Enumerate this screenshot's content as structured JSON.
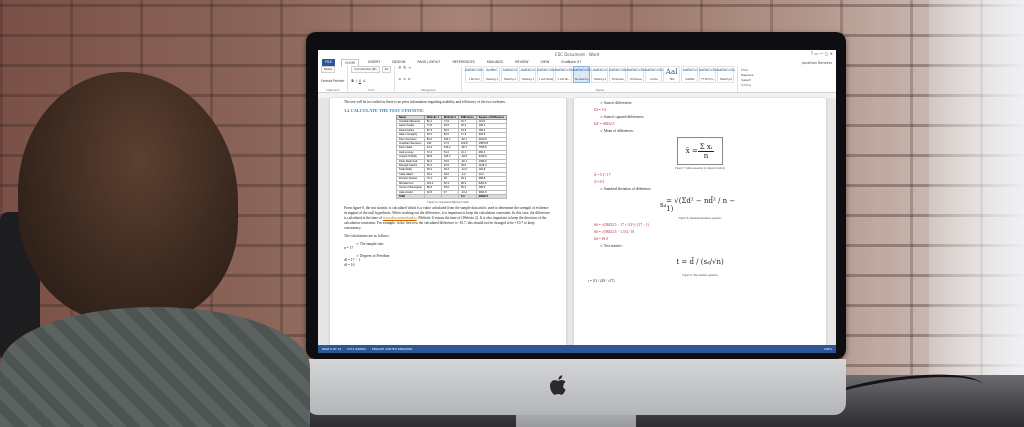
{
  "photo": {
    "description_only": false
  },
  "word": {
    "title": "CSC Document - Word",
    "tabs": [
      "FILE",
      "HOME",
      "INSERT",
      "DESIGN",
      "PAGE LAYOUT",
      "REFERENCES",
      "MAILINGS",
      "REVIEW",
      "VIEW",
      "EndNote X7"
    ],
    "active_tab": "HOME",
    "user": "Jonathan Beneers",
    "clipboard": {
      "paste": "Paste",
      "format_painter": "Format Painter",
      "group": "Clipboard"
    },
    "font": {
      "name": "Constantia (Bo",
      "size": "10",
      "group": "Font"
    },
    "paragraph_group": "Paragraph",
    "styles_group": "Styles",
    "styles": [
      {
        "sample": "AaBbCcDc",
        "name": "1 Normal"
      },
      {
        "sample": "AaBbC",
        "name": "Heading 1"
      },
      {
        "sample": "AaBbCcI",
        "name": "Heading 2"
      },
      {
        "sample": "AaBbCcI",
        "name": "Heading 3"
      },
      {
        "sample": "AaBbCcDc",
        "name": "1 List Bullet"
      },
      {
        "sample": "AaBbCcDc",
        "name": "1 List Nu..."
      },
      {
        "sample": "AaBbCcDc",
        "name": "No Spacing"
      },
      {
        "sample": "AaBbCcI",
        "name": "Heading 4"
      },
      {
        "sample": "AaBbCcDc",
        "name": "Emphasis"
      },
      {
        "sample": "AaBbCcDc",
        "name": "Emphasis"
      },
      {
        "sample": "AaBbCcDc",
        "name": "Quote"
      },
      {
        "sample": "AaI",
        "name": "Title"
      },
      {
        "sample": "AaBbCcI",
        "name": "Subtitle"
      },
      {
        "sample": "AaBbCcDc",
        "name": "TT Std Hy..."
      },
      {
        "sample": "AaBbCcDc",
        "name": "Heading 6"
      }
    ],
    "editing": {
      "find": "Find",
      "replace": "Replace",
      "select": "Select",
      "group": "Editing"
    },
    "left_page": {
      "intro": "The test will be two tailed as there is no prior information regarding usability and efficiency of the two websites.",
      "heading": "3.4 CALCULATE THE TEST STATISTIC",
      "table_headers": [
        "Name",
        "Website 1",
        "Website 2",
        "Difference",
        "Square of Difference"
      ],
      "table_rows": [
        [
          "Jonathan Beneers",
          "81.2",
          "71.9",
          "10.7",
          "114.5"
        ],
        [
          "Aaron Fowler",
          "71.8",
          "49.6",
          "22.2",
          "100.3"
        ],
        [
          "David Collins",
          "87.3",
          "56.0",
          "31.3",
          "199.2"
        ],
        [
          "Adam Geraghty",
          "94.2",
          "52.0",
          "17.4",
          "302.8"
        ],
        [
          "Dan Lhompson",
          "81.0",
          "102.1",
          "-52.1",
          "2616.8"
        ],
        [
          "Jonathan Sampson",
          "130",
          "27.2",
          "102.8",
          "10579.8"
        ],
        [
          "Dewn Salla",
          "44.4",
          "120.2",
          "-66.7",
          "7535.5"
        ],
        [
          "Jack Looney",
          "72.4",
          "51.2",
          "21.1",
          "260.2"
        ],
        [
          "Joseph O'Reilly",
          "86.8",
          "105.4",
          "-18.6",
          "3429.9"
        ],
        [
          "Peter Redmond",
          "52.2",
          "78.6",
          "-46.1",
          "1396.0"
        ],
        [
          "Darragh Kearns",
          "76.4",
          "42.8",
          "33.6",
          "1129.0"
        ],
        [
          "Keith Reilly",
          "35.4",
          "48.4",
          "-12.0",
          "162.8"
        ],
        [
          "Clara Halpin",
          "29.4",
          "33.6",
          "-3.4",
          "10.2"
        ],
        [
          "Dominic Rowan",
          "70.1",
          "38",
          "39.1",
          "386.8"
        ],
        [
          "Michael Kerr",
          "115.2",
          "52.3",
          "90.9",
          "8261.8"
        ],
        [
          "James O'Donoghue",
          "86.8",
          "45.6",
          "65.2",
          "180.9"
        ],
        [
          "Jade Arnold",
          "32.8",
          "47",
          "-13.4",
          "3901.5"
        ]
      ],
      "sum_row": [
        "SUM",
        "",
        "",
        "5.3",
        "38432.5"
      ],
      "caption": "Figure 6: Calculated difference table",
      "para1": "From figure 6, the test statistic is calculated which is a value calculated from the sample data and is used to determine the strength of evidence in support of the null hypothesis. When working out the difference, it is important to keep the calculation consistent. In this case, the difference is calculated at the time of",
      "link": "www.discoverireland.ie",
      "para2": "(Website 1) minus the time of (Website 2). It is also important to keep the direction of the calculation consistent. For example, in the first row the calculated difference is -10.7, this should not be changed to be +10.7 to keep consistency.",
      "calc_intro": "The calculations are as follows:",
      "bullet1": "The sample size:",
      "n_expr": "n = 17",
      "bullet2": "Degrees of Freedom:",
      "df_expr": "df = 17 − 1",
      "df_result": "df = 16"
    },
    "right_page": {
      "bullet_sum": "Sum of differences:",
      "sum_expr": "Σd = 5.3",
      "bullet_sq": "Sum of squared differences:",
      "sq_expr": "Σd² = 38432.5",
      "bullet_mean": "Mean of differences:",
      "mean_formula_num": "Σ xᵢ",
      "mean_formula_den": "n",
      "mean_caption": "Figure 7: Mean equation (x replaced with d)",
      "dbar_expr": "d̄ = 5.3 / 17",
      "dbar_result": "d̄ = 0.3",
      "bullet_sd": "Standard deviation of difference:",
      "sd_caption": "Figure 8: Standard deviation equation",
      "sd_lines": [
        "Sd = √(38432.5 − 17 × 0.3²) / (17 − 1)",
        "Sd = √(38432.5 − 1.53) / 16",
        "Sd = 49.0"
      ],
      "bullet_t": "Test statistic:",
      "t_caption": "Figure 9: Test statistic equation",
      "t_expr": "t = 0.3 / (49 / √17)"
    },
    "status": {
      "page": "PAGE 6 OF 19",
      "words": "2372 WORDS",
      "lang": "ENGLISH (UNITED KINGDOM)",
      "zoom": "100%"
    }
  }
}
